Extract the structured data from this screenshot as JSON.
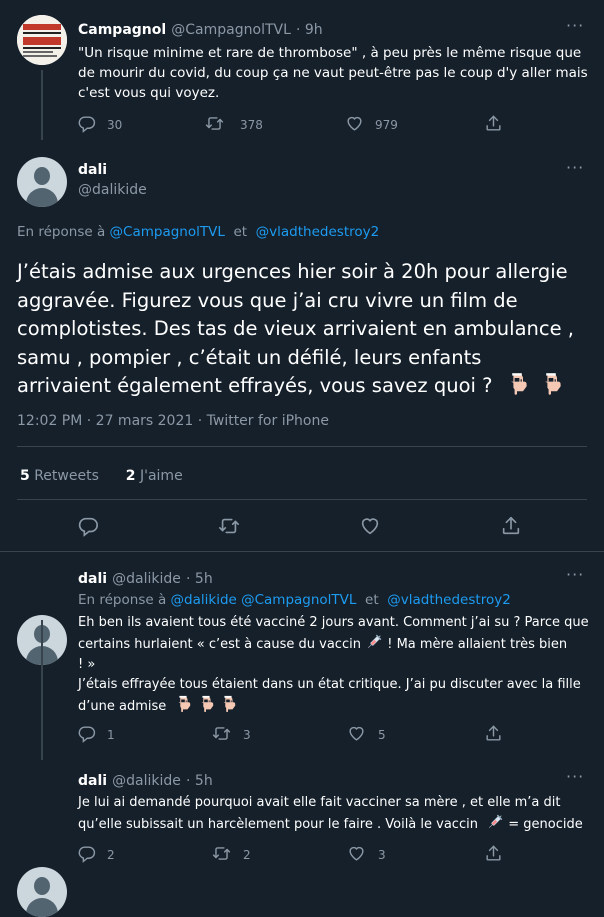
{
  "tweets": {
    "t1": {
      "name": "Campagnol",
      "handle": "@CampagnolTVL",
      "time": "· 9h",
      "lines": [
        "\"Un risque minime et rare de thrombose\" , à peu près le même risque que",
        "de mourir du covid, du coup ça ne vaut peut-être pas le coup d'y aller mais",
        "c'est vous qui voyez."
      ],
      "replies": "30",
      "retweets": "378",
      "likes": "979",
      "avatar_text": "LA FRANCE DE CAMPAGNOL"
    },
    "main": {
      "name": "dali",
      "handle": "@dalikide",
      "reply_prefix": "En réponse à",
      "mention1": "@CampagnolTVL",
      "and": "et",
      "mention2": "@vladthedestroy2",
      "lines": [
        "J’étais admise aux urgences hier soir à 20h pour allergie",
        "aggravée. Figurez vous que j’ai cru vivre un film de",
        "complotistes. Des tas de vieux arrivaient en ambulance ,",
        "samu , pompier , c’était un défilé, leurs enfants",
        "arrivaient également effrayés, vous savez quoi ?"
      ],
      "meta": "12:02 PM · 27 mars 2021 · Twitter for iPhone",
      "retweets_count": "5",
      "retweets_label": "Retweets",
      "likes_count": "2",
      "likes_label": "J'aime"
    },
    "r1": {
      "name": "dali",
      "handle": "@dalikide",
      "time": "· 5h",
      "reply_prefix": "En réponse à",
      "mention1": "@dalikide @CampagnolTVL",
      "and": "et",
      "mention2": "@vladthedestroy2",
      "line1": "Eh ben ils avaient tous été vacciné 2 jours avant. Comment j’ai su ? Parce que",
      "line2a": "certains hurlaient «  c’est à cause du vaccin",
      "line2b": " ! Ma mère allaient très bien",
      "line3": "! »",
      "line4": "J’étais effrayée tous étaient dans un état critique. J’ai pu discuter avec la fille",
      "line5": "d’une admise",
      "replies": "1",
      "retweets": "3",
      "likes": "5"
    },
    "r2": {
      "name": "dali",
      "handle": "@dalikide",
      "time": "· 5h",
      "line1": "Je lui ai demandé pourquoi avait elle fait vacciner sa mère , et elle m’a dit",
      "line2a": "qu’elle subissait un harcèlement pour le faire . Voilà le vaccin",
      "line2b": " = genocide",
      "replies": "2",
      "retweets": "2",
      "likes": "3"
    }
  },
  "colors": {
    "background": "#15202b",
    "link": "#1d9bf0",
    "muted": "#8b98a5",
    "divider": "#38444d"
  },
  "icons": [
    "more-icon",
    "reply-icon",
    "retweet-icon",
    "like-icon",
    "share-icon",
    "pointing-down-emoji",
    "syringe-emoji"
  ]
}
